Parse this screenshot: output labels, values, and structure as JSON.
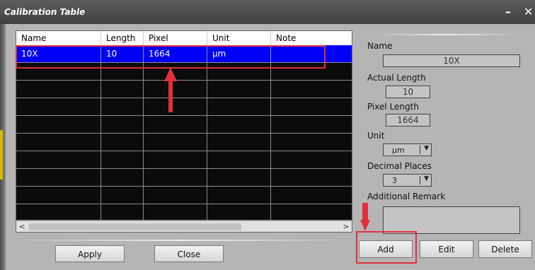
{
  "window": {
    "title": "Calibration Table",
    "minimize_glyph": "–",
    "close_glyph": "✕"
  },
  "table": {
    "columns": [
      "Name",
      "Length",
      "Pixel",
      "Unit",
      "Note"
    ],
    "rows": [
      {
        "name": "10X",
        "length": "10",
        "pixel": "1664",
        "unit": "μm",
        "note": ""
      }
    ],
    "empty_row_count": 9
  },
  "scrollbar": {
    "left_arrow": "<",
    "right_arrow": ">"
  },
  "buttons": {
    "apply": "Apply",
    "close": "Close",
    "add": "Add",
    "edit": "Edit",
    "delete": "Delete"
  },
  "form": {
    "name_label": "Name",
    "name_value": "10X",
    "actual_length_label": "Actual Length",
    "actual_length_value": "10",
    "pixel_length_label": "Pixel Length",
    "pixel_length_value": "1664",
    "unit_label": "Unit",
    "unit_value": "μm",
    "decimal_label": "Decimal Places",
    "decimal_value": "3",
    "remark_label": "Additional Remark",
    "remark_value": ""
  },
  "colors": {
    "selection": "#0000f6",
    "annotation": "#e0303a",
    "titlebar": "#4a4a4a",
    "panel": "#b5b5b5"
  },
  "icons": {
    "dropdown": "caret-down-icon",
    "annotation_arrow": "red-arrow-icon"
  }
}
